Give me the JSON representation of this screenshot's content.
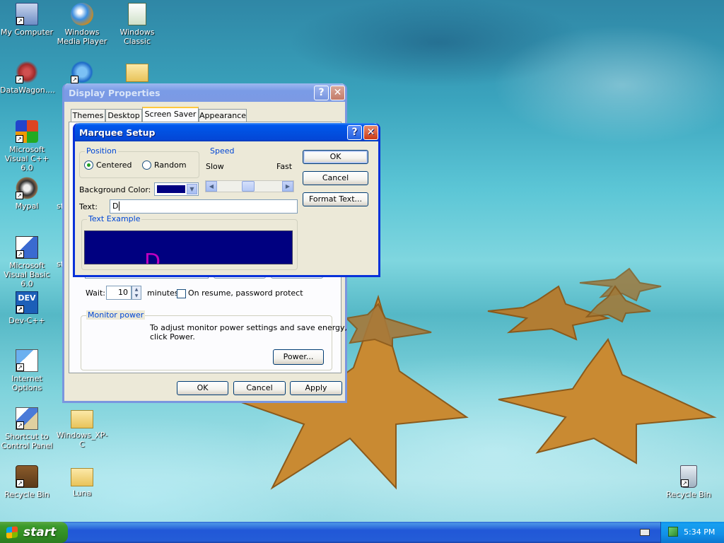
{
  "desktop": {
    "icons": [
      {
        "label": "My Computer"
      },
      {
        "label": "Windows Media Player"
      },
      {
        "label": "Windows Classic"
      },
      {
        "label": "DataWagon...."
      },
      {
        "label": "Microsoft Visual C++ 6.0"
      },
      {
        "label": "Mypal"
      },
      {
        "label": "Microsoft Visual Basic 6.0"
      },
      {
        "label": "Dev-C++"
      },
      {
        "label": "Internet Options"
      },
      {
        "label": "Shortcut to Control Panel"
      },
      {
        "label": "Windows_XP-C"
      },
      {
        "label": "Recycle Bin"
      },
      {
        "label": "Luna"
      },
      {
        "label": "Recycle Bin"
      }
    ],
    "partial_labels": [
      "st",
      "st"
    ]
  },
  "display_properties": {
    "title": "Display Properties",
    "tabs": [
      "Themes",
      "Desktop",
      "Screen Saver",
      "Appearance"
    ],
    "active_tab": "Screen Saver",
    "wait_label": "Wait:",
    "wait_value": "10",
    "minutes_label": "minutes",
    "resume_label": "On resume, password protect",
    "monitor_power_label": "Monitor power",
    "monitor_power_text_1": "To adjust monitor power settings and save energy,",
    "monitor_power_text_2": "click Power.",
    "power_button": "Power...",
    "ok": "OK",
    "cancel": "Cancel",
    "apply": "Apply"
  },
  "marquee_setup": {
    "title": "Marquee Setup",
    "position_label": "Position",
    "centered": "Centered",
    "random": "Random",
    "position_selected": "Centered",
    "speed_label": "Speed",
    "slow": "Slow",
    "fast": "Fast",
    "background_color_label": "Background Color:",
    "background_color": "#000080",
    "text_label": "Text:",
    "text_value": "D",
    "text_example_label": "Text Example",
    "example_char": "D",
    "example_color": "#c000c0",
    "ok": "OK",
    "cancel": "Cancel",
    "format_text": "Format Text..."
  },
  "taskbar": {
    "start": "start",
    "clock": "5:34 PM"
  }
}
